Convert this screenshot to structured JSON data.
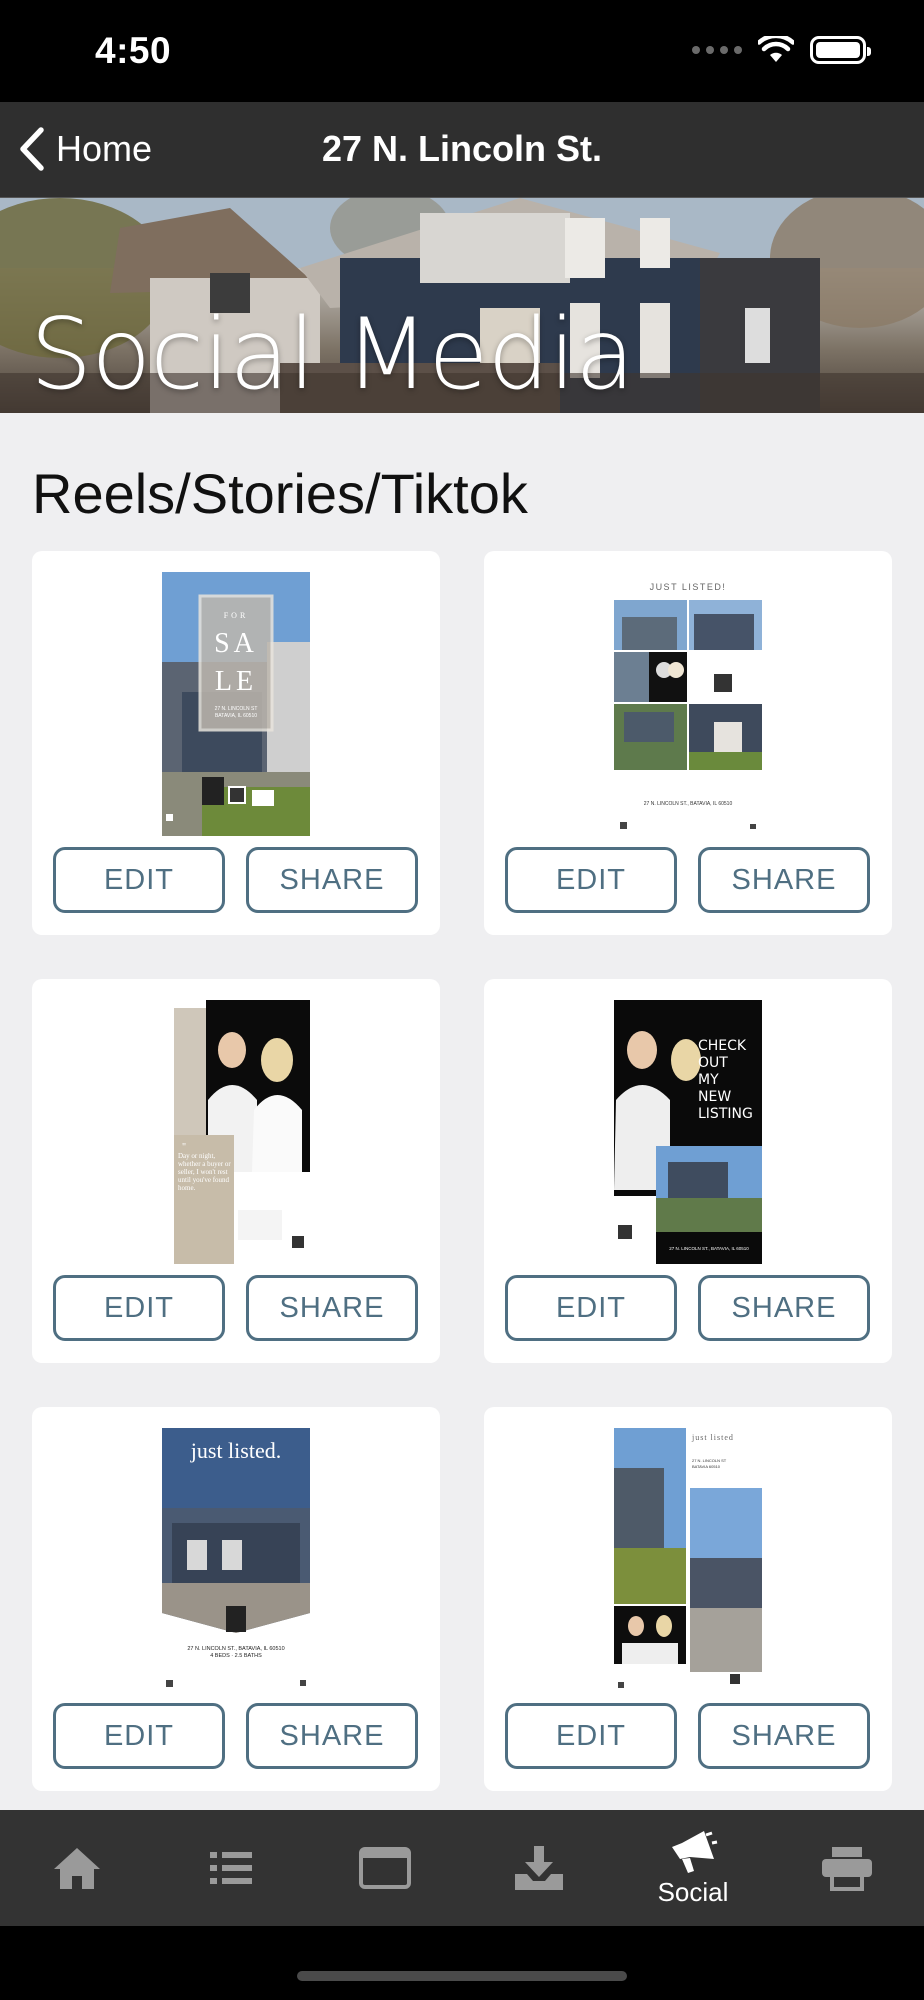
{
  "status_bar": {
    "time": "4:50"
  },
  "nav": {
    "back_label": "Home",
    "title": "27 N. Lincoln St."
  },
  "hero": {
    "title": "Social Media"
  },
  "section": {
    "title": "Reels/Stories/Tiktok"
  },
  "cards": [
    {
      "thumb_text": [
        "FOR",
        "SA",
        "LE",
        "27 N. LINCOLN ST",
        "BATAVIA, IL 60510"
      ],
      "edit_label": "EDIT",
      "share_label": "SHARE"
    },
    {
      "thumb_text": [
        "JUST LISTED!",
        "27 N. LINCOLN ST., BATAVIA, IL 60510"
      ],
      "edit_label": "EDIT",
      "share_label": "SHARE"
    },
    {
      "thumb_text": [
        "Day or night, whether a buyer or seller, I won't rest until you've found home."
      ],
      "edit_label": "EDIT",
      "share_label": "SHARE"
    },
    {
      "thumb_text": [
        "CHECK",
        "OUT",
        "MY",
        "NEW",
        "LISTING",
        "27 N. LINCOLN ST., BATAVIA, IL 60510"
      ],
      "edit_label": "EDIT",
      "share_label": "SHARE"
    },
    {
      "thumb_text": [
        "just listed.",
        "27 N. LINCOLN ST., BATAVIA, IL 60510",
        "4 BEDS · 2.5 BATHS"
      ],
      "edit_label": "EDIT",
      "share_label": "SHARE"
    },
    {
      "thumb_text": [
        "just listed",
        "27 N. LINCOLN ST",
        "BATAVIA 60510"
      ],
      "edit_label": "EDIT",
      "share_label": "SHARE"
    }
  ],
  "tabs": [
    {
      "icon": "home-icon",
      "label": ""
    },
    {
      "icon": "list-icon",
      "label": ""
    },
    {
      "icon": "browser-window-icon",
      "label": ""
    },
    {
      "icon": "download-tray-icon",
      "label": ""
    },
    {
      "icon": "megaphone-icon",
      "label": "Social",
      "active": true
    },
    {
      "icon": "printer-icon",
      "label": ""
    }
  ],
  "colors": {
    "accent": "#4f6f82",
    "nav_bg": "#2f2f2f",
    "tab_bg": "#333333",
    "content_bg": "#efeff1"
  }
}
